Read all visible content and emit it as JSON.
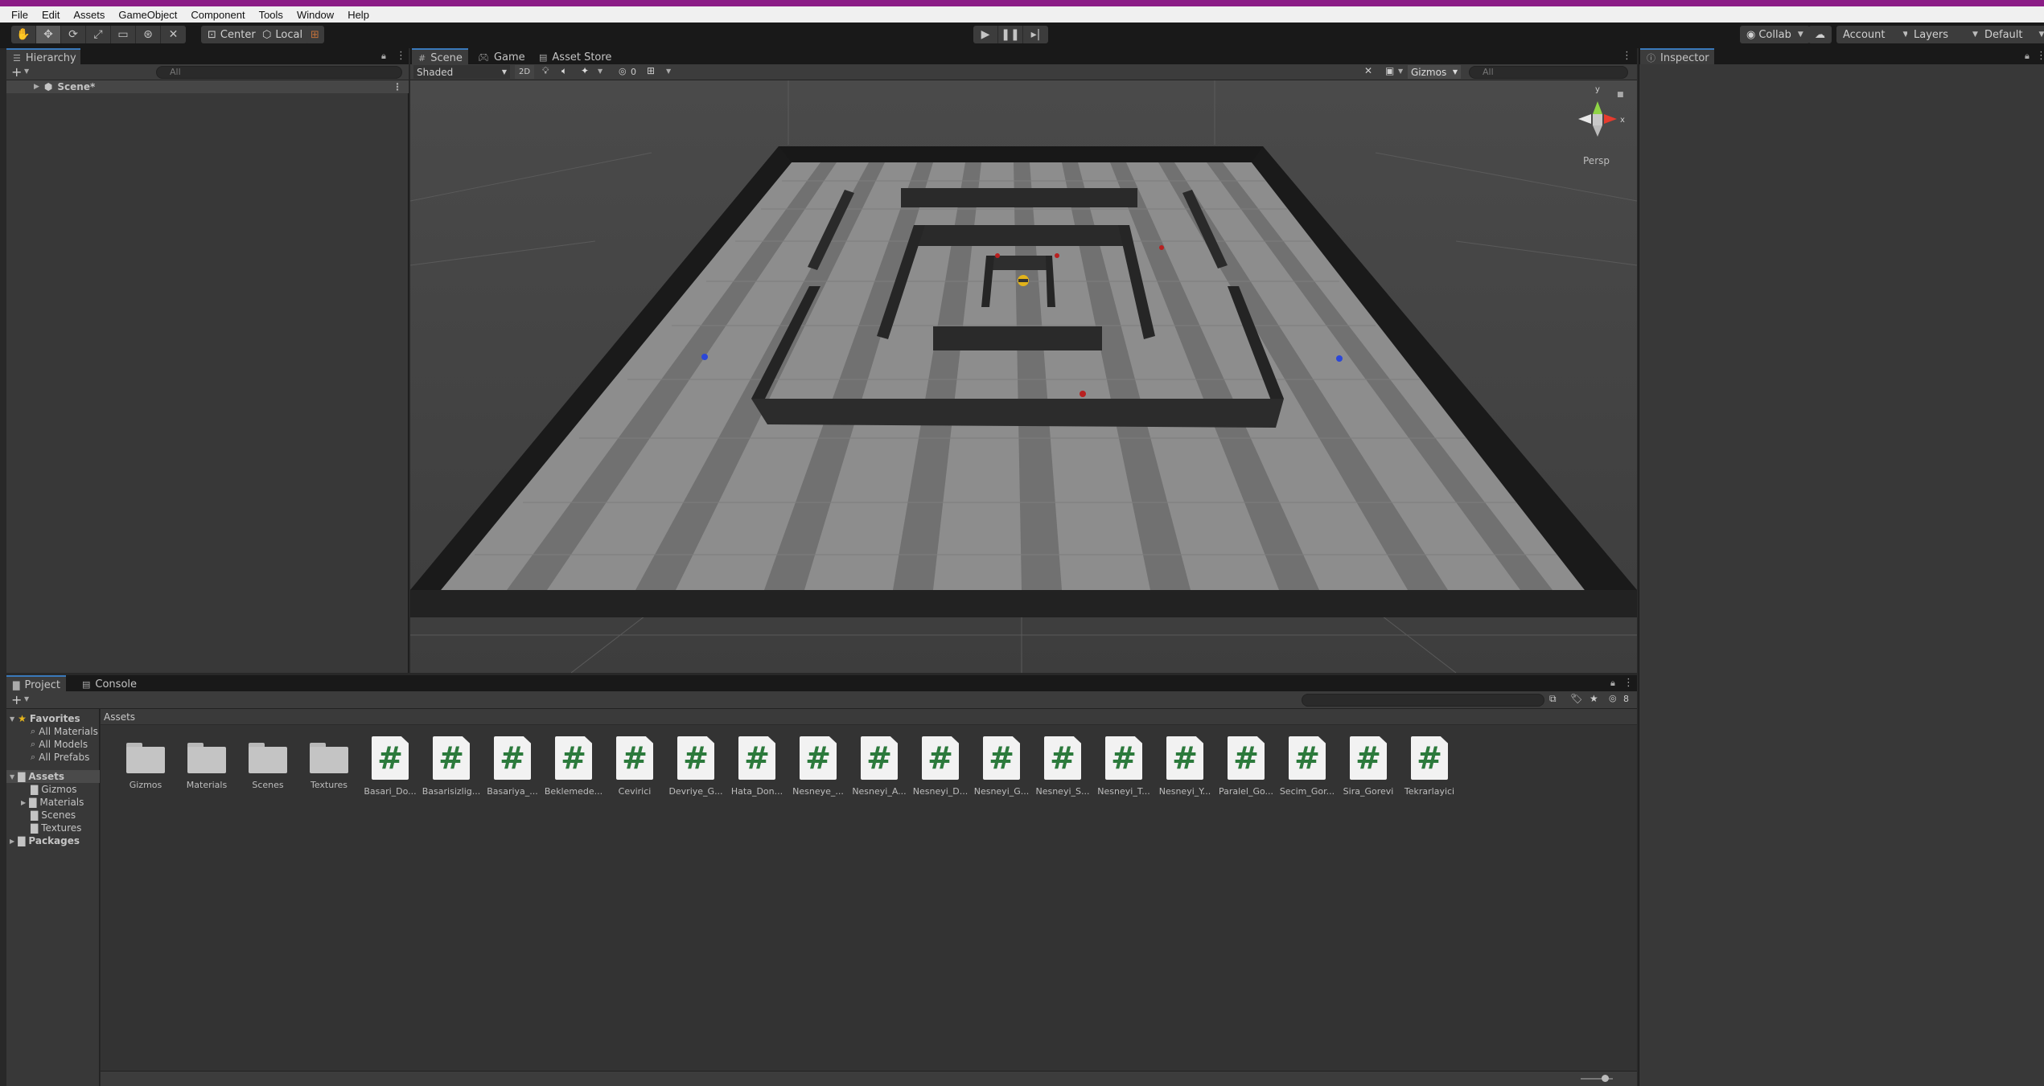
{
  "menu": [
    "File",
    "Edit",
    "Assets",
    "GameObject",
    "Component",
    "Tools",
    "Window",
    "Help"
  ],
  "toolbar": {
    "pivot_label": "Center",
    "space_label": "Local",
    "collab_label": "Collab",
    "account_label": "Account",
    "layers_label": "Layers",
    "layout_label": "Default",
    "tool_icons": [
      "hand-icon",
      "move-icon",
      "rotate-icon",
      "scale-icon",
      "rect-tool-icon",
      "transform-icon",
      "custom-tool-icon"
    ]
  },
  "hierarchy": {
    "tab_label": "Hierarchy",
    "search_placeholder": "All",
    "scene_item": "Scene*"
  },
  "scene": {
    "tabs": [
      "Scene",
      "Game",
      "Asset Store"
    ],
    "shading_mode": "Shaded",
    "mode_2d": "2D",
    "hidden_count": "0",
    "gizmos_label": "Gizmos",
    "search_placeholder": "All",
    "projection_label": "Persp",
    "axis_labels": {
      "x": "x",
      "y": "y"
    }
  },
  "inspector": {
    "tab_label": "Inspector"
  },
  "project": {
    "tabs": [
      "Project",
      "Console"
    ],
    "breadcrumb": "Assets",
    "hidden_count": "8",
    "favorites": {
      "label": "Favorites",
      "items": [
        "All Materials",
        "All Models",
        "All Prefabs"
      ]
    },
    "assets_root": "Assets",
    "assets_children": [
      "Gizmos",
      "Materials",
      "Scenes",
      "Textures"
    ],
    "packages_label": "Packages",
    "folders": [
      "Gizmos",
      "Materials",
      "Scenes",
      "Textures"
    ],
    "scripts": [
      "Basari_Do...",
      "Basarisizlig...",
      "Basariya_...",
      "Beklemede...",
      "Cevirici",
      "Devriye_G...",
      "Hata_Don...",
      "Nesneye_...",
      "Nesneyi_A...",
      "Nesneyi_D...",
      "Nesneyi_G...",
      "Nesneyi_S...",
      "Nesneyi_T...",
      "Nesneyi_Y...",
      "Paralel_Go...",
      "Secim_Gor...",
      "Sira_Gorevi",
      "Tekrarlayici"
    ],
    "script_glyph": "#"
  }
}
